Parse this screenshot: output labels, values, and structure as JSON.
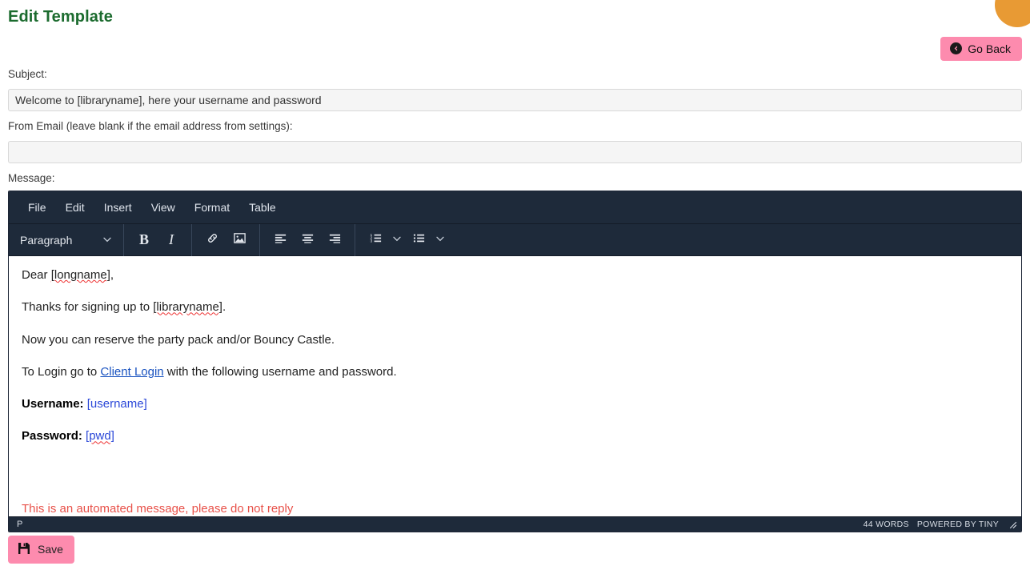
{
  "page": {
    "title": "Edit Template",
    "title_color": "#1b6b2e",
    "accent_pink": "#fd8bae",
    "accent_orange": "#e89a34"
  },
  "go_back": {
    "label": "Go Back",
    "icon": "arrow-circle-left-icon"
  },
  "fields": {
    "subject": {
      "label": "Subject:",
      "value": "Welcome to [libraryname], here your username and password",
      "placeholder": ""
    },
    "from_email": {
      "label": "From Email (leave blank if the email address from settings):",
      "value": "",
      "placeholder": ""
    },
    "message": {
      "label": "Message:"
    }
  },
  "editor": {
    "menubar": [
      "File",
      "Edit",
      "Insert",
      "View",
      "Format",
      "Table"
    ],
    "toolbar": {
      "format_select": "Paragraph",
      "bold": "B",
      "italic": "I",
      "link_icon": "link-icon",
      "image_icon": "image-icon",
      "align_left_icon": "align-left-icon",
      "align_center_icon": "align-center-icon",
      "align_right_icon": "align-right-icon",
      "numbered_list_icon": "ordered-list-icon",
      "bullet_list_icon": "unordered-list-icon",
      "chevron_icon": "chevron-down-icon"
    },
    "content": {
      "line1_pre": "Dear ",
      "line1_token": "[longname]",
      "line1_post": ",",
      "line2_pre": "Thanks for signing up to ",
      "line2_token": "[libraryname]",
      "line2_post": ".",
      "line3": "Now you can reserve the party pack and/or Bouncy Castle.",
      "line4_pre": "To Login go to ",
      "line4_link": "Client Login",
      "line4_post": " with the following username and password.",
      "username_label": "Username:",
      "username_token": "[username]",
      "password_label": "Password:",
      "password_token": "[pwd]",
      "footer_note": "This is an automated message, please do not reply"
    },
    "statusbar": {
      "path": "P",
      "word_count": "44 WORDS",
      "brand": "POWERED BY TINY",
      "resize_icon": "resize-handle-icon"
    }
  },
  "save": {
    "label": "Save",
    "icon": "floppy-disk-save-icon"
  }
}
